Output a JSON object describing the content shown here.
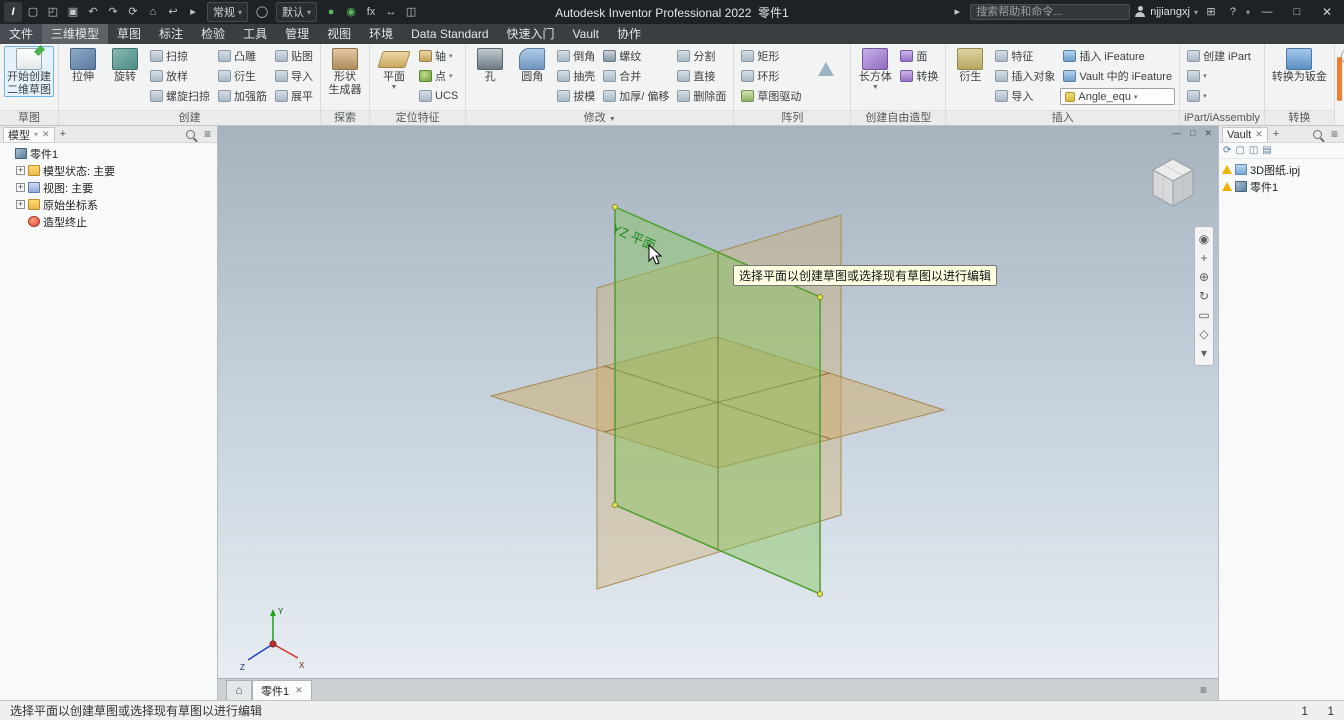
{
  "titlebar": {
    "app_title": "Autodesk Inventor Professional 2022",
    "doc_title": "零件1",
    "search_placeholder": "搜索帮助和命令...",
    "user": "njjiangxj",
    "dropdown1": "常规",
    "dropdown2": "默认",
    "icons_a": [
      {
        "n": "app-logo",
        "g": "I",
        "cls": "logo"
      },
      {
        "n": "new-file-icon",
        "g": "▢"
      },
      {
        "n": "open-icon",
        "g": "◰"
      },
      {
        "n": "save-icon",
        "g": "▣"
      },
      {
        "n": "undo-icon",
        "g": "↶"
      },
      {
        "n": "redo-icon",
        "g": "↷"
      },
      {
        "n": "update-icon",
        "g": "⟳"
      },
      {
        "n": "home-view-icon",
        "g": "⌂"
      },
      {
        "n": "return-icon",
        "g": "↩"
      },
      {
        "n": "select-dropdown-icon",
        "g": "▸"
      }
    ],
    "icons_b": [
      {
        "n": "sync-ok-icon",
        "g": "●",
        "c": "#5cb85c"
      },
      {
        "n": "upload-status-icon",
        "g": "◉",
        "c": "#5cb85c"
      },
      {
        "n": "fx-parameters-icon",
        "g": "fx"
      },
      {
        "n": "measure-icon",
        "g": "↔"
      },
      {
        "n": "collaborate-icon",
        "g": "◫"
      }
    ],
    "globe_icon": "◯",
    "help_label": "?"
  },
  "tabs": [
    {
      "label": "文件",
      "cls": "t-file"
    },
    {
      "label": "三维模型",
      "cls": "t-active"
    },
    {
      "label": "草图"
    },
    {
      "label": "标注"
    },
    {
      "label": "检验"
    },
    {
      "label": "工具"
    },
    {
      "label": "管理"
    },
    {
      "label": "视图"
    },
    {
      "label": "环境"
    },
    {
      "label": "Data Standard"
    },
    {
      "label": "快速入门"
    },
    {
      "label": "Vault"
    },
    {
      "label": "协作"
    }
  ],
  "ribbon": {
    "sketch": {
      "group": "草图",
      "line1": "开始创建",
      "line2": "二维草图"
    },
    "create": {
      "group": "创建",
      "big1": "拉伸",
      "big2": "旋转",
      "col1": [
        {
          "label": "扫掠",
          "icon": "sweep"
        },
        {
          "label": "放样",
          "icon": "loft"
        },
        {
          "label": "螺旋扫掠",
          "icon": "coil"
        }
      ],
      "col2": [
        {
          "label": "凸雕",
          "icon": "emboss"
        },
        {
          "label": "衍生",
          "icon": "derive"
        },
        {
          "label": "加强筋",
          "icon": "rib"
        }
      ],
      "col3": [
        {
          "label": "贴图",
          "icon": "decal"
        },
        {
          "label": "导入",
          "icon": "import"
        },
        {
          "label": "展平",
          "icon": "unwrap"
        }
      ]
    },
    "explore": {
      "group": "探索",
      "line1": "形状",
      "line2": "生成器"
    },
    "workfeat": {
      "group": "定位特征",
      "big": "平面",
      "big_caret": "▼",
      "col": [
        {
          "label": "轴",
          "icon": "axis",
          "caret": "▾"
        },
        {
          "label": "点",
          "icon": "point",
          "caret": "▾"
        },
        {
          "label": "UCS",
          "icon": "ucs"
        }
      ]
    },
    "modify": {
      "group": "修改",
      "group_caret": "▼",
      "big1": "孔",
      "big2": "圆角",
      "col1": [
        {
          "label": "倒角",
          "icon": "chamfer"
        },
        {
          "label": "抽壳",
          "icon": "shell"
        },
        {
          "label": "拔模",
          "icon": "draft"
        }
      ],
      "col2": [
        {
          "label": "螺纹",
          "icon": "thread"
        },
        {
          "label": "合并",
          "icon": "combine"
        },
        {
          "label": "加厚/ 偏移",
          "icon": "thicken"
        }
      ],
      "col3": [
        {
          "label": "分割",
          "icon": "split"
        },
        {
          "label": "直接",
          "icon": "direct"
        },
        {
          "label": "删除面",
          "icon": "delface"
        }
      ]
    },
    "pattern": {
      "group": "阵列",
      "col": [
        {
          "label": "矩形",
          "icon": "rectpat"
        },
        {
          "label": "环形",
          "icon": "circpat"
        },
        {
          "label": "草图驱动",
          "icon": "sketchpat"
        }
      ]
    },
    "freeform": {
      "group": "创建自由造型",
      "big": "长方体",
      "big_caret": "▼",
      "col": [
        {
          "label": "面",
          "icon": "fface"
        },
        {
          "label": "转换",
          "icon": "fconvert"
        }
      ]
    },
    "insert": {
      "group": "插入",
      "big": "衍生",
      "col1": [
        {
          "label": "特征",
          "icon": "featins"
        },
        {
          "label": "插入对象",
          "icon": "insobj"
        },
        {
          "label": "导入",
          "icon": "importins"
        }
      ],
      "col2": [
        {
          "label": "插入 iFeature",
          "icon": "ifeature"
        },
        {
          "label": "Vault 中的 iFeature",
          "icon": "vaultif"
        }
      ],
      "combo": "Angle_equ",
      "combo_caret": "▾"
    },
    "ipart": {
      "group": "iPart/iAssembly",
      "col": [
        {
          "label": "创建 iPart",
          "icon": "ipartc"
        },
        {
          "label": "",
          "icon": "iparttable",
          "caret": "▾"
        },
        {
          "label": "",
          "icon": "ipartlist",
          "caret": "▾"
        }
      ]
    },
    "convert": {
      "group": "转换",
      "big": "转换为钣金"
    }
  },
  "browser": {
    "tab": "模型",
    "items": [
      {
        "icon": "part",
        "label": "零件1",
        "indent": 0,
        "expander": ""
      },
      {
        "icon": "folder",
        "label": "模型状态: 主要",
        "indent": 1,
        "expander": "+"
      },
      {
        "icon": "view",
        "label": "视图: 主要",
        "indent": 1,
        "expander": "+"
      },
      {
        "icon": "folder",
        "label": "原始坐标系",
        "indent": 1,
        "expander": "+"
      },
      {
        "icon": "end",
        "label": "造型终止",
        "indent": 1,
        "expander": ""
      }
    ]
  },
  "vault": {
    "tab": "Vault",
    "toolbar": [
      {
        "n": "refresh-icon",
        "g": "⟳"
      },
      {
        "n": "new-doc-icon",
        "g": "▢"
      },
      {
        "n": "copy-icon",
        "g": "◫"
      },
      {
        "n": "grid-icon",
        "g": "▤"
      }
    ],
    "items": [
      {
        "icon": "proj",
        "label": "3D图纸.ipj"
      },
      {
        "icon": "part",
        "label": "零件1"
      }
    ]
  },
  "viewport": {
    "tooltip": "选择平面以创建草图或选择现有草图以进行编辑",
    "plane_label": "YZ 平面",
    "triad": {
      "x": "X",
      "y": "Y",
      "z": "Z"
    },
    "navbar": [
      {
        "n": "nav-wheel-icon",
        "g": "◉"
      },
      {
        "n": "pan-icon",
        "g": "+"
      },
      {
        "n": "zoom-icon",
        "g": "⊕"
      },
      {
        "n": "orbit-icon",
        "g": "↻"
      },
      {
        "n": "look-at-icon",
        "g": "▭"
      },
      {
        "n": "view-face-icon",
        "g": "◇"
      },
      {
        "n": "more-tools-icon",
        "g": "▾"
      }
    ],
    "win_controls": [
      "—",
      "□",
      "✕"
    ]
  },
  "doctabs": {
    "active_tab": "零件1"
  },
  "statusbar": {
    "message": "选择平面以创建草图或选择现有草图以进行编辑",
    "n1": "1",
    "n2": "1"
  }
}
